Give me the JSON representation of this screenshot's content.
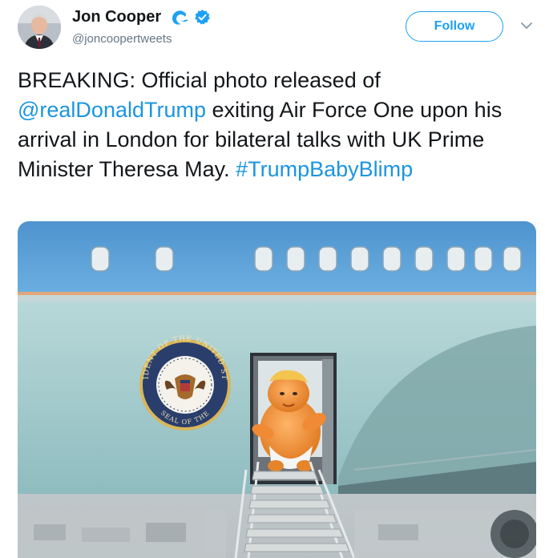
{
  "user": {
    "name": "Jon Cooper",
    "handle": "@joncoopertweets",
    "badges": [
      "wave-icon",
      "verified-icon"
    ]
  },
  "actions": {
    "follow_label": "Follow",
    "menu_icon": "chevron-down-icon"
  },
  "tweet": {
    "text_before": "BREAKING: Official photo released of ",
    "mention": "@realDonaldTrump",
    "text_after": " exiting Air Force One upon his arrival in London for bilateral talks with UK Prime Minister Theresa May. ",
    "hashtag": "#TrumpBabyBlimp"
  },
  "media": {
    "seal_top_text": "PRESIDENT OF THE UNITED STATES",
    "seal_bottom_text": "SEAL OF THE"
  },
  "colors": {
    "link": "#1b95e0",
    "follow_accent": "#1da1f2",
    "verified": "#1da1f2",
    "plane_blue": "#5f9ed1",
    "plane_body": "#a8cdd0"
  }
}
